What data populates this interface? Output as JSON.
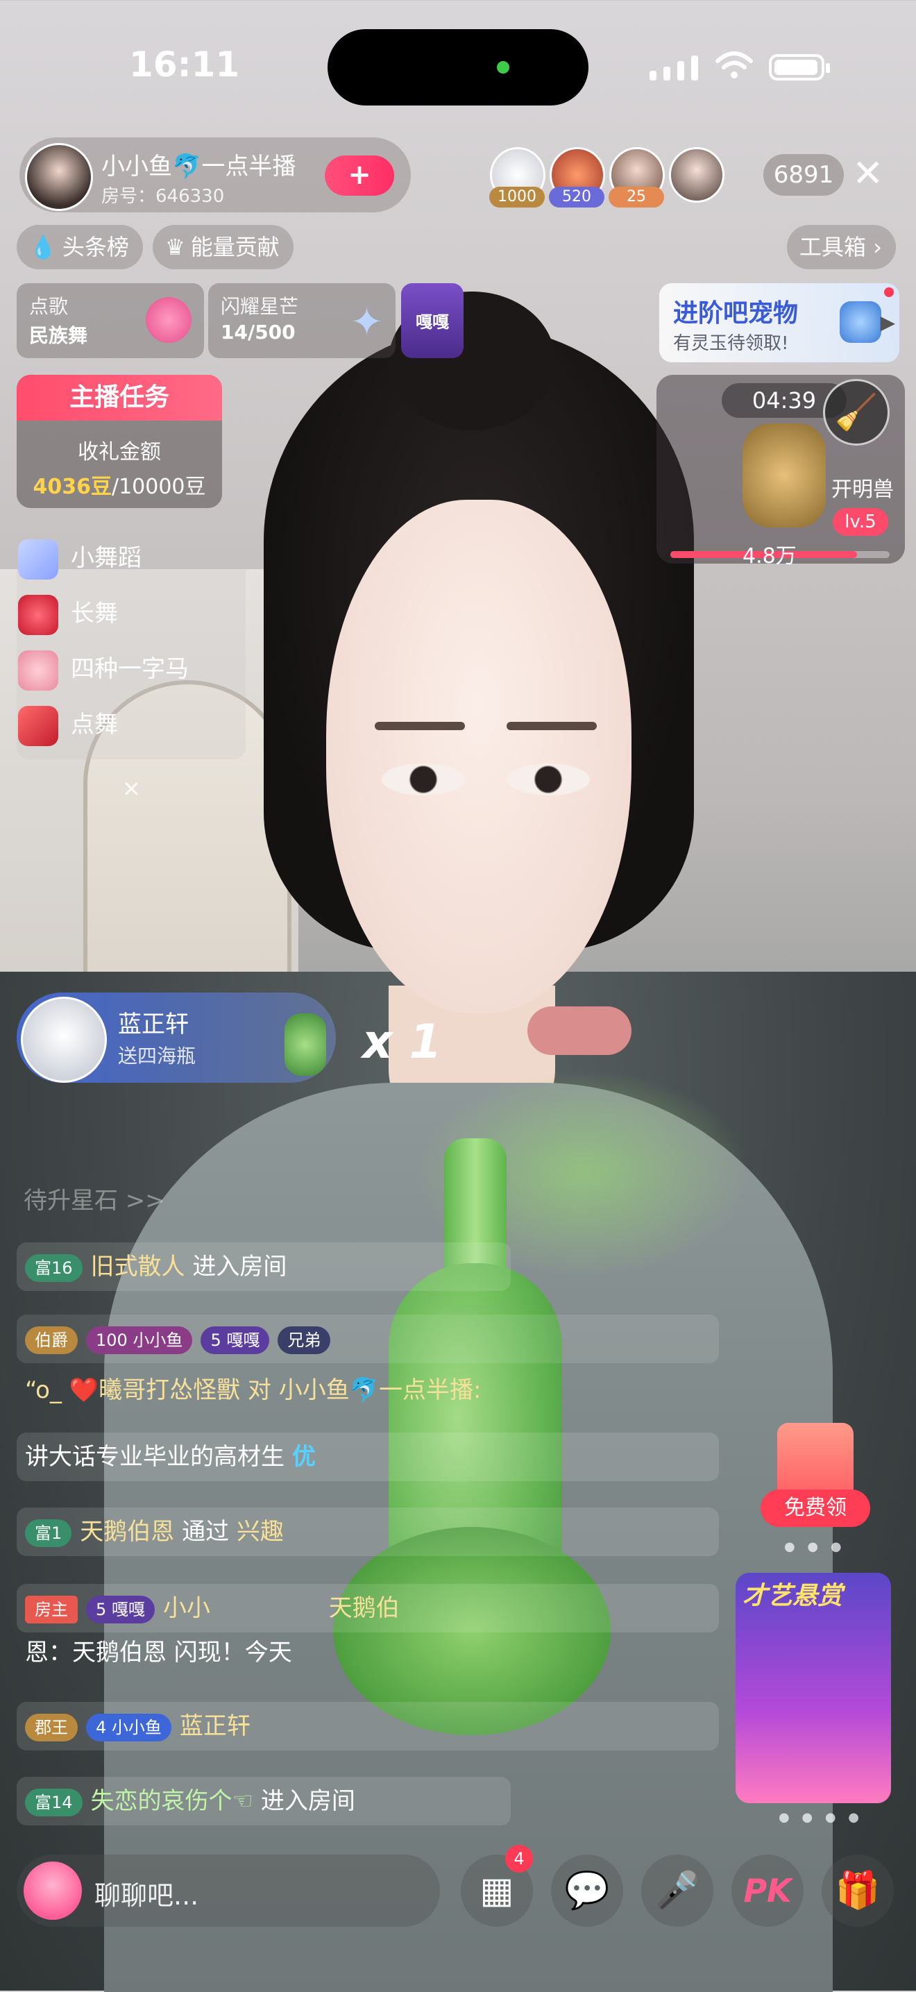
{
  "status": {
    "time": "16:11"
  },
  "host": {
    "name": "小小鱼🐬一点半播",
    "room": "房号：646330",
    "follow": "+"
  },
  "viewers": [
    {
      "badge": "1000",
      "color": "#b8893f"
    },
    {
      "badge": "520",
      "color": "#6a6ad8"
    },
    {
      "badge": "25",
      "color": "#e58a52"
    },
    {
      "badge": "",
      "color": ""
    }
  ],
  "online_count": "6891",
  "chips": {
    "headline": "头条榜",
    "energy": "能量贡献",
    "toolbox": "工具箱"
  },
  "cards": {
    "song": {
      "label": "点歌",
      "value": "民族舞"
    },
    "star": {
      "label": "闪耀星芒",
      "value": "14/500"
    },
    "badge_text": "嘎嘎"
  },
  "pet": {
    "title": "进阶吧宠物",
    "subtitle": "有灵玉待领取!"
  },
  "task": {
    "title": "主播任务",
    "label": "收礼金额",
    "current": "4036豆",
    "target": "/10000豆"
  },
  "songs": [
    "小舞蹈",
    "长舞",
    "四种一字马",
    "点舞"
  ],
  "beast": {
    "timer": "04:39",
    "name": "开明兽",
    "level": "lv.5",
    "value": "4.8万",
    "progress": 0.85
  },
  "gift": {
    "user": "蓝正轩",
    "desc": "送四海瓶",
    "multiplier": "x 1"
  },
  "faded_text": "待升星石 >>",
  "chat": {
    "r1": {
      "lvl": "富16",
      "name": "旧式散人",
      "action": "进入房间"
    },
    "r2": {
      "lvl": "伯爵",
      "b1": "100 小小鱼",
      "b2": "5 嘎嘎",
      "b3": "兄弟"
    },
    "r3": {
      "text": "“o_ ❤️曦哥打怂怪獸 对 小小鱼🐬一点半播:"
    },
    "r4": {
      "text": "讲大话专业毕业的高材生",
      "tail": "优"
    },
    "r5": {
      "lvl": "富1",
      "name": "天鹅伯恩",
      "action": "通过",
      "tail": "兴趣"
    },
    "r6": {
      "lvl": "房主",
      "b1": "5 嘎嘎",
      "name": "小小",
      "tail": "天鹅伯"
    },
    "r7": {
      "text": "恩：天鹅伯恩 闪现！今天"
    },
    "r8": {
      "lvl": "郡王",
      "b1": "4 小小鱼",
      "name": "蓝正轩"
    },
    "r9": {
      "lvl": "富14",
      "name": "失恋的哀伤个☜",
      "action": "进入房间"
    }
  },
  "free_gift": {
    "label": "免费领"
  },
  "promo": {
    "title": "才艺悬赏"
  },
  "bottom": {
    "placeholder": "聊聊吧...",
    "badge": "4",
    "pk": "PK"
  }
}
